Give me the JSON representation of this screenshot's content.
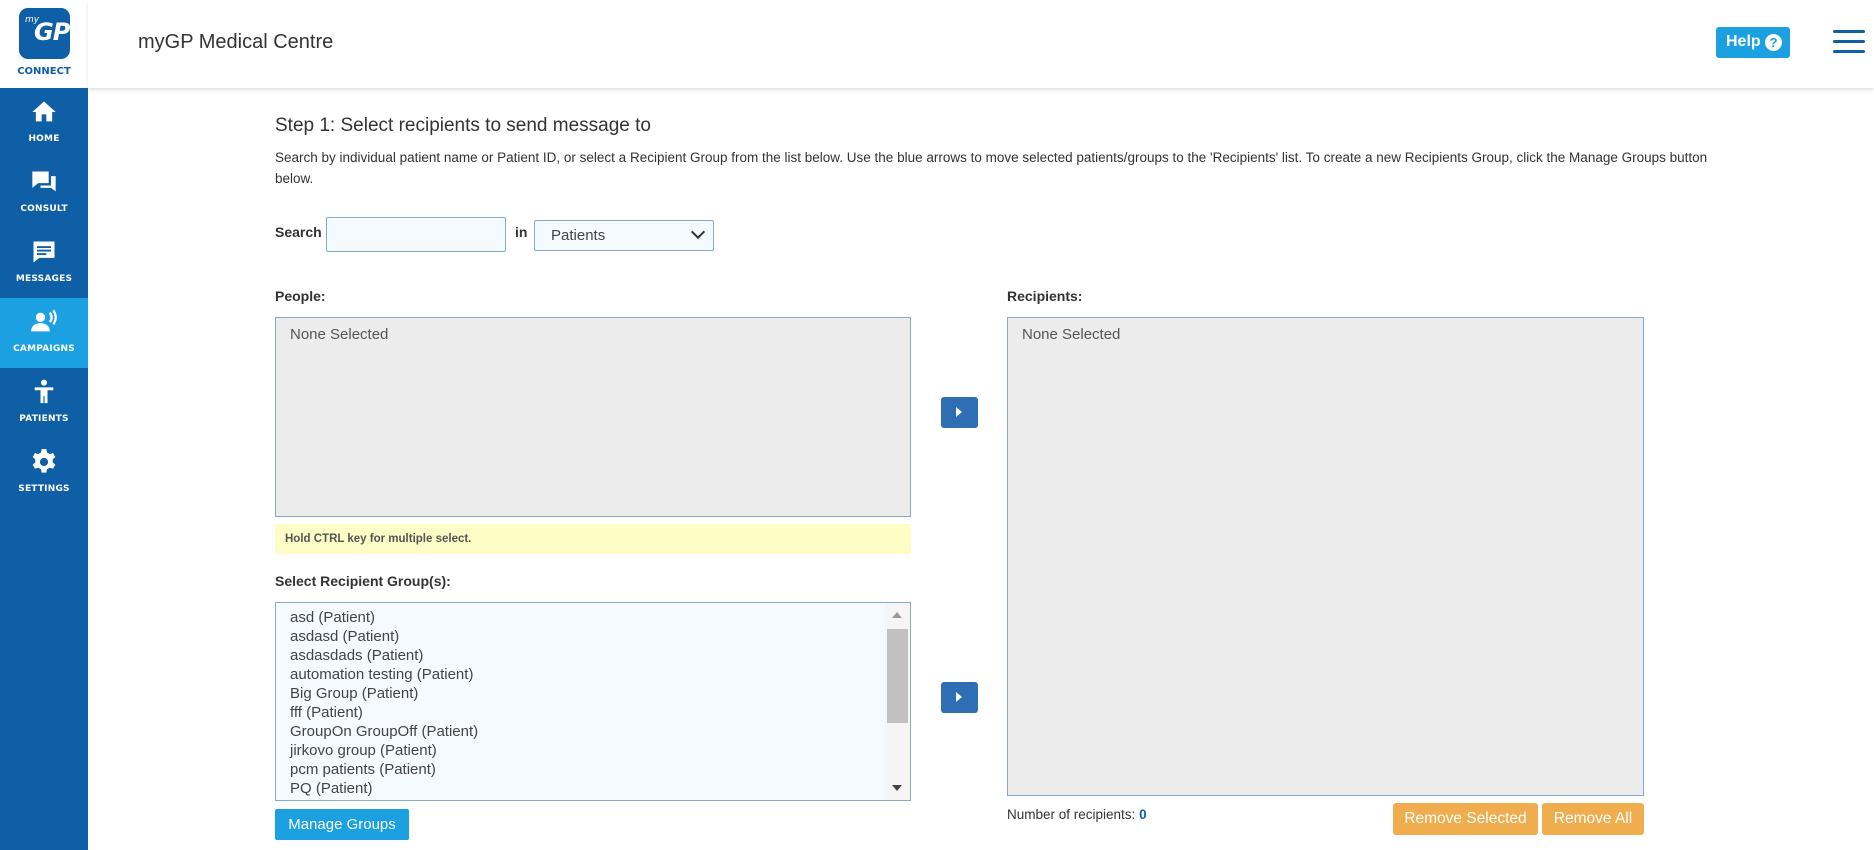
{
  "logo": {
    "my": "my",
    "gp": "GP",
    "caption": "CONNECT"
  },
  "sidebar": {
    "items": [
      {
        "label": "HOME",
        "icon": "home-icon",
        "active": false
      },
      {
        "label": "CONSULT",
        "icon": "chat-bubbles-icon",
        "active": false
      },
      {
        "label": "MESSAGES",
        "icon": "message-icon",
        "active": false
      },
      {
        "label": "CAMPAIGNS",
        "icon": "broadcast-person-icon",
        "active": true
      },
      {
        "label": "PATIENTS",
        "icon": "person-icon",
        "active": false
      },
      {
        "label": "SETTINGS",
        "icon": "gear-icon",
        "active": false
      }
    ]
  },
  "header": {
    "title": "myGP Medical Centre",
    "help_label": "Help",
    "help_icon": "?"
  },
  "step": {
    "title": "Step 1: Select recipients to send message to",
    "description": "Search by individual patient name or Patient ID, or select a Recipient Group from the list below. Use the blue arrows to move selected patients/groups to the 'Recipients' list. To create a new Recipients Group, click the Manage Groups button below."
  },
  "search": {
    "label": "Search",
    "value": "",
    "placeholder": "",
    "in_label": "in",
    "scope_selected": "Patients"
  },
  "people": {
    "label": "People:",
    "empty_text": "None Selected",
    "hint": "Hold CTRL key for multiple select."
  },
  "groups": {
    "label": "Select Recipient Group(s):",
    "items": [
      "asd (Patient)",
      "asdasd (Patient)",
      "asdasdads (Patient)",
      "automation testing (Patient)",
      "Big Group (Patient)",
      "fff (Patient)",
      "GroupOn GroupOff (Patient)",
      "jirkovo group (Patient)",
      "pcm patients (Patient)",
      "PQ (Patient)"
    ],
    "manage_label": "Manage Groups"
  },
  "recipients": {
    "label": "Recipients:",
    "empty_text": "None Selected",
    "count_label": "Number of recipients:",
    "count": "0",
    "remove_selected_label": "Remove Selected",
    "remove_all_label": "Remove All"
  },
  "colors": {
    "brand": "#0e5fa6",
    "accent": "#1ba1e2",
    "arrow": "#2f6eb5",
    "warning": "#f0ad4e",
    "hint_bg": "#fffdc6"
  }
}
